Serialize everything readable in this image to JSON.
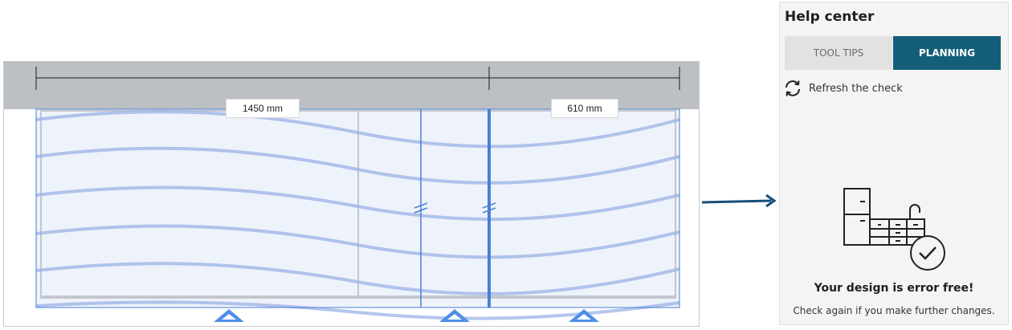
{
  "canvas": {
    "dimension_left": "1450 mm",
    "dimension_right": "610 mm",
    "colors": {
      "wall": "#bcc0c5",
      "selection": "#4a7fd4",
      "wave": "#9bb3e6",
      "marker": "#4f8fe8"
    }
  },
  "help_center": {
    "title": "Help center",
    "tabs": [
      {
        "label": "TOOL TIPS",
        "active": false
      },
      {
        "label": "PLANNING",
        "active": true
      }
    ],
    "refresh_label": "Refresh the check",
    "refresh_icon": "refresh-icon",
    "illustration_icon": "kitchen-check-icon",
    "status_title": "Your design is error free!",
    "status_message": "Check again if you make further changes.",
    "colors": {
      "active_tab": "#135f7a",
      "inactive_tab": "#e2e2e2"
    }
  }
}
